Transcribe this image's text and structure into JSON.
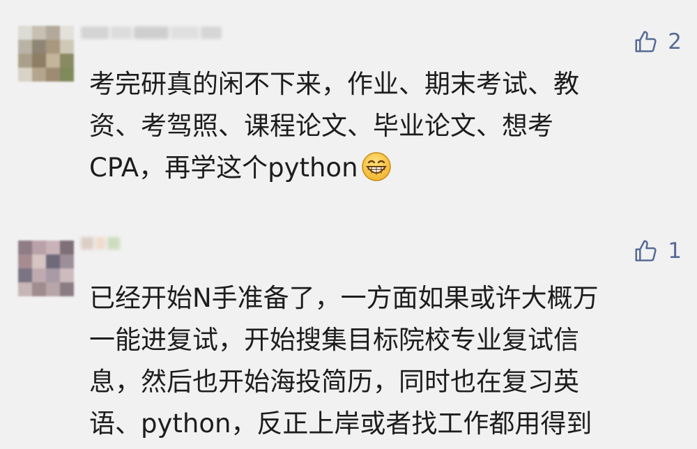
{
  "comments": [
    {
      "lines": [
        "考完研真的闲不下来，作业、期末考试、教",
        "资、考驾照、课程论文、毕业论文、想考",
        "CPA，再学这个python"
      ],
      "emoji": "grin-emoji",
      "likes": "2"
    },
    {
      "lines": [
        "已经开始N手准备了，一方面如果或许大概万",
        "一能进复试，开始搜集目标院校专业复试信",
        "息，然后也开始海投简历，同时也在复习英",
        "语、python，反正上岸或者找工作都用得到"
      ],
      "likes": "1"
    }
  ],
  "colors": {
    "background": "#f1f1f1",
    "like_accent": "#576b95",
    "text": "#1d1d1d"
  },
  "icons": [
    "thumbs-up-icon",
    "grin-emoji"
  ]
}
